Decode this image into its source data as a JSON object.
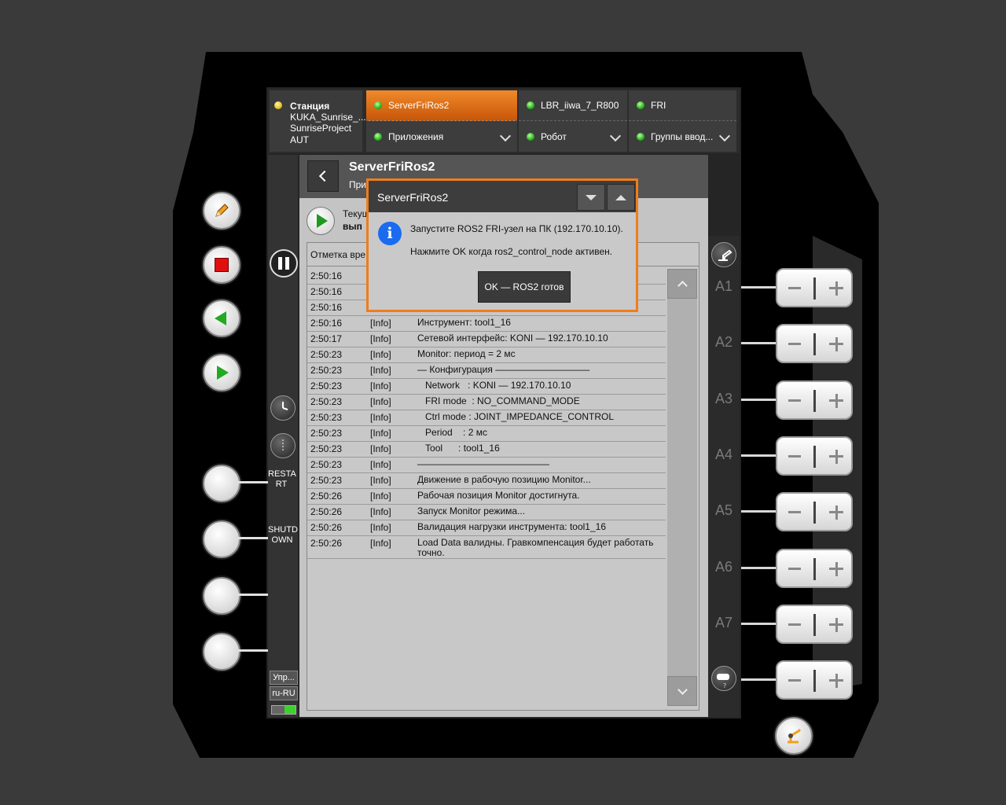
{
  "station": {
    "title": "Станция",
    "line1": "KUKA_Sunrise_...",
    "line2": "SunriseProject",
    "line3": "AUT"
  },
  "tabs": [
    {
      "upper": "ServerFriRos2",
      "lower": "Приложения"
    },
    {
      "upper": "LBR_iiwa_7_R800",
      "lower": "Робот"
    },
    {
      "upper": "FRI",
      "lower": "Группы ввод..."
    }
  ],
  "app": {
    "title": "ServerFriRos2",
    "subtitle": "При",
    "state_label": "Текущ",
    "state_value": "вып"
  },
  "sidebar": {
    "restart": "RESTA RT",
    "shutdown": "SHUTD OWN",
    "manage": "Упр...",
    "locale": "ru-RU"
  },
  "log": {
    "header": "Отметка вре",
    "rows": [
      {
        "time": "2:50:16",
        "level": "",
        "msg": ""
      },
      {
        "time": "2:50:16",
        "level": "",
        "msg": ""
      },
      {
        "time": "2:50:16",
        "level": "",
        "msg": ""
      },
      {
        "time": "2:50:16",
        "level": "[Info]",
        "msg": "Инструмент: tool1_16"
      },
      {
        "time": "2:50:17",
        "level": "[Info]",
        "msg": "Сетевой интерфейс: KONI — 192.170.10.10"
      },
      {
        "time": "2:50:23",
        "level": "[Info]",
        "msg": "Monitor: период = 2 мс"
      },
      {
        "time": "2:50:23",
        "level": "[Info]",
        "msg": "— Конфигурация ——————————"
      },
      {
        "time": "2:50:23",
        "level": "[Info]",
        "msg": "   Network   : KONI — 192.170.10.10"
      },
      {
        "time": "2:50:23",
        "level": "[Info]",
        "msg": "   FRI mode  : NO_COMMAND_MODE"
      },
      {
        "time": "2:50:23",
        "level": "[Info]",
        "msg": "   Ctrl mode : JOINT_IMPEDANCE_CONTROL"
      },
      {
        "time": "2:50:23",
        "level": "[Info]",
        "msg": "   Period    : 2 мс"
      },
      {
        "time": "2:50:23",
        "level": "[Info]",
        "msg": "   Tool      : tool1_16"
      },
      {
        "time": "2:50:23",
        "level": "[Info]",
        "msg": "——————————————"
      },
      {
        "time": "2:50:23",
        "level": "[Info]",
        "msg": "Движение в рабочую позицию Monitor..."
      },
      {
        "time": "2:50:26",
        "level": "[Info]",
        "msg": "Рабочая позиция Monitor достигнута."
      },
      {
        "time": "2:50:26",
        "level": "[Info]",
        "msg": "Запуск Monitor режима..."
      },
      {
        "time": "2:50:26",
        "level": "[Info]",
        "msg": "Валидация нагрузки инструмента: tool1_16"
      },
      {
        "time": "2:50:26",
        "level": "[Info]",
        "msg": "Load Data валидны. Гравкомпенсация будет работать точно."
      }
    ]
  },
  "dialog": {
    "title": "ServerFriRos2",
    "line1": "Запустите ROS2 FRI-узел на ПК (192.170.10.10).",
    "line2": "Нажмите OK когда ros2_control_node активен.",
    "ok": "OK — ROS2 готов",
    "info_icon": "i"
  },
  "axes": [
    "A1",
    "A2",
    "A3",
    "A4",
    "A5",
    "A6",
    "A7"
  ],
  "colors": {
    "accent": "#f07d1a",
    "led_green": "#25b51c",
    "info_blue": "#1a6bf0"
  }
}
